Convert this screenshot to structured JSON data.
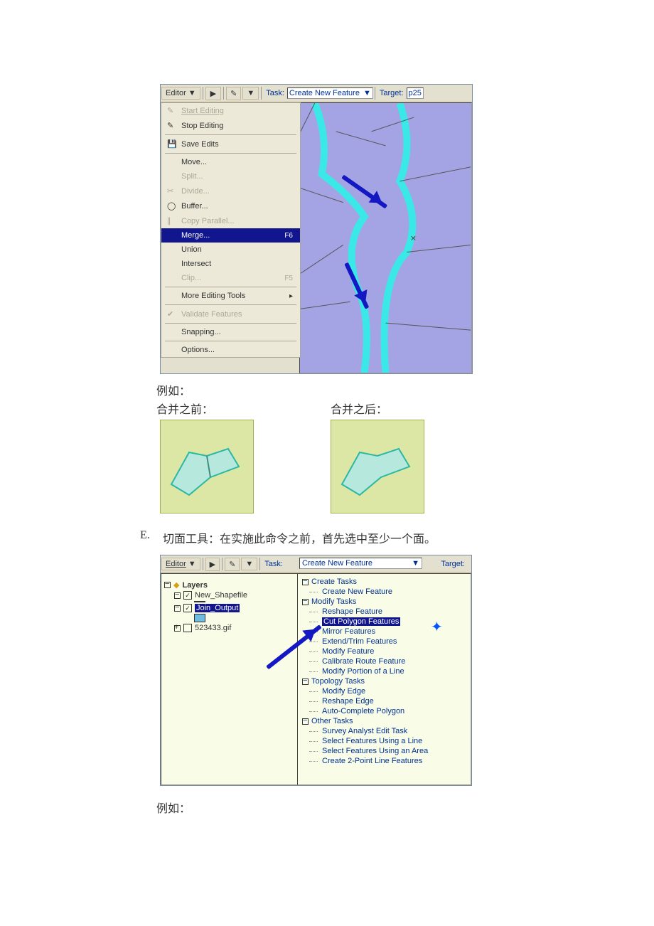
{
  "fig1": {
    "editor_btn": "Editor",
    "task_label": "Task:",
    "task_value": "Create New Feature",
    "target_label": "Target:",
    "target_value": "p25",
    "menu": {
      "start_editing": "Start Editing",
      "stop_editing": "Stop Editing",
      "save_edits": "Save Edits",
      "move": "Move...",
      "split": "Split...",
      "divide": "Divide...",
      "buffer": "Buffer...",
      "copy_parallel": "Copy Parallel...",
      "merge": "Merge...",
      "merge_shortcut": "F6",
      "union": "Union",
      "intersect": "Intersect",
      "clip": "Clip...",
      "clip_shortcut": "F5",
      "more_tools": "More Editing Tools",
      "validate": "Validate Features",
      "snapping": "Snapping...",
      "options": "Options..."
    }
  },
  "captions": {
    "example": "例如：",
    "before": "合并之前：",
    "after": "合并之后：",
    "sectionE": "E.",
    "sectionE_text": "切面工具：在实施此命令之前，首先选中至少一个面。",
    "example2": "例如："
  },
  "fig2": {
    "editor_btn": "Editor",
    "task_label": "Task:",
    "task_value": "Create New Feature",
    "target_label": "Target:",
    "toc": {
      "layers": "Layers",
      "new_shapefile": "New_Shapefile",
      "join_output": "Join_Output",
      "gif": "523433.gif"
    },
    "tasks": {
      "create_tasks": "Create Tasks",
      "create_new_feature": "Create New Feature",
      "modify_tasks": "Modify Tasks",
      "reshape_feature": "Reshape Feature",
      "cut_polygon": "Cut Polygon Features",
      "mirror": "Mirror Features",
      "extend_trim": "Extend/Trim Features",
      "modify_feature": "Modify Feature",
      "calibrate": "Calibrate Route Feature",
      "modify_portion": "Modify Portion of a Line",
      "topology_tasks": "Topology Tasks",
      "modify_edge": "Modify Edge",
      "reshape_edge": "Reshape Edge",
      "auto_complete": "Auto-Complete Polygon",
      "other_tasks": "Other Tasks",
      "survey": "Survey Analyst Edit Task",
      "select_line": "Select Features Using a Line",
      "select_area": "Select Features Using an Area",
      "create_2point": "Create 2-Point Line Features"
    }
  }
}
